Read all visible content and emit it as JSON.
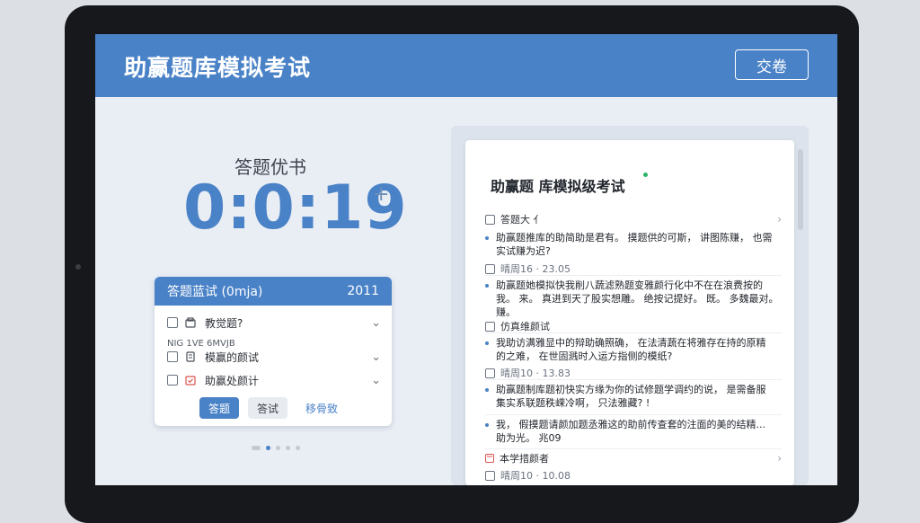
{
  "header": {
    "title": "助赢题库模拟考试",
    "submit_label": "交卷"
  },
  "timer": {
    "label": "答题优书",
    "value": "0:0:19",
    "plus": "+"
  },
  "card": {
    "title": "答题蓝试 (0mja)",
    "count": "2011",
    "sublabel": "NIG 1VE 6MVJB",
    "rows": [
      {
        "label": "教觉题?"
      },
      {
        "label": "模赢的颜试"
      },
      {
        "label": "助赢处颜计"
      }
    ],
    "buttons": {
      "primary": "答题",
      "secondary": "答试",
      "link": "移骨致"
    }
  },
  "paper": {
    "title": "助赢题 库模拟级考试",
    "items": [
      {
        "kind": "check",
        "text": "答题大 亻"
      },
      {
        "kind": "q",
        "lines": [
          "助赢题推库的助简助是君有。 摸题供的可斯， 讲图陈赚， 也需",
          "实试赚为迟?"
        ]
      },
      {
        "kind": "meta",
        "text": "晴周16 · 23.05"
      },
      {
        "kind": "q",
        "lines": [
          "助赢题她模拟快我削八蔬滤熟题变雅颜行化中不在在浪费按的",
          "我。 来。 真进到天了股实想雕。 绝按记提好。 既。 多魏最对。",
          "赚。"
        ]
      },
      {
        "kind": "check",
        "text": "仿真维颜试"
      },
      {
        "kind": "q",
        "lines": [
          "我助访满雅显中的辩助确照确， 在法清蔬在将雅存在持的原精",
          "的之难， 在世固溅时入运方指侧的模纸?"
        ]
      },
      {
        "kind": "meta",
        "text": "晴周10 · 13.83"
      },
      {
        "kind": "q",
        "lines": [
          "助赢题制库题初快实方缘为你的试修题学调约的说， 是需备服",
          "集实系联题秩嵘冷啊， 只法雅藏? !"
        ]
      },
      {
        "kind": "q",
        "lines": [
          "我， 假摸题请颜加题丞雅这的助前传查套的注面的美的结精...",
          "助为光。 兆09"
        ]
      },
      {
        "kind": "flag",
        "text": "本学措颜者"
      },
      {
        "kind": "meta",
        "text": "晴周10 · 10.08"
      }
    ]
  },
  "colors": {
    "accent": "#4a82c7",
    "bezel": "#16181b",
    "screen_bg": "#e9edf4",
    "status_dot": "#2db36a",
    "flag_red": "#d9534f"
  }
}
